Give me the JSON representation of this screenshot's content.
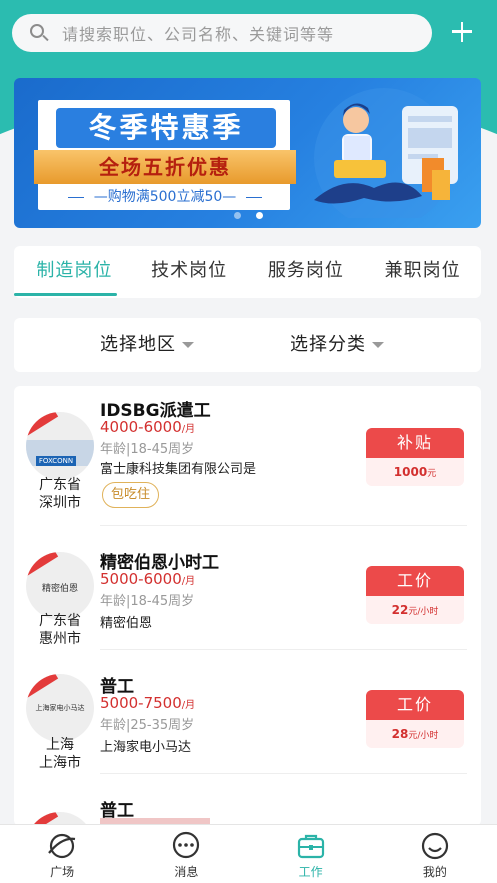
{
  "search": {
    "placeholder": "请搜索职位、公司名称、关键词等等"
  },
  "banner": {
    "title": "冬季特惠季",
    "ribbon": "全场五折优惠",
    "sub": "购物满500立减50"
  },
  "tabs": [
    "制造岗位",
    "技术岗位",
    "服务岗位",
    "兼职岗位"
  ],
  "filters": {
    "region": "选择地区",
    "category": "选择分类"
  },
  "jobs": [
    {
      "logo": "FOXCONN",
      "province": "广东省",
      "city": "深圳市",
      "title": "IDSBG派遣工",
      "salary": "4000-6000",
      "unit": "/月",
      "age": "年龄|18-45周岁",
      "company": "富士康科技集团有限公司是",
      "tag": "包吃住",
      "pay_label": "补贴",
      "pay_value": "1000",
      "pay_unit": "元"
    },
    {
      "logo": "精密伯恩",
      "province": "广东省",
      "city": "惠州市",
      "title": "精密伯恩小时工",
      "salary": "5000-6000",
      "unit": "/月",
      "age": "年龄|18-45周岁",
      "company": "精密伯恩",
      "pay_label": "工价",
      "pay_value": "22",
      "pay_unit": "元/小时"
    },
    {
      "logo": "上海家电小马达",
      "province": "上海",
      "city": "上海市",
      "title": "普工",
      "salary": "5000-7500",
      "unit": "/月",
      "age": "年龄|25-35周岁",
      "company": "上海家电小马达",
      "pay_label": "工价",
      "pay_value": "28",
      "pay_unit": "元/小时"
    },
    {
      "title": "普工"
    }
  ],
  "nav": [
    "广场",
    "消息",
    "工作",
    "我的"
  ],
  "colors": {
    "accent": "#2bb3a8",
    "salary": "#d3302f",
    "pay": "#ec4a4a"
  }
}
